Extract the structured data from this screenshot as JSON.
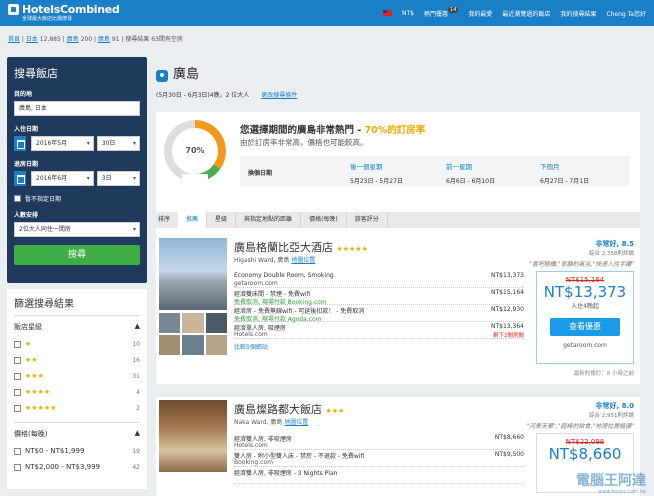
{
  "topbar": {
    "logo": "HotelsCombined",
    "tagline": "全球最大飯店比價搜尋",
    "currency": "NT$",
    "popular": "熱門優惠",
    "popular_badge": "14",
    "favorites": "我的最愛",
    "recent": "最近瀏覽過的飯店",
    "my_search": "我的搜尋結果",
    "user": "Cheng Ta您好"
  },
  "breadcrumb": {
    "home": "首頁",
    "japan": "日本",
    "japan_count": "12,885",
    "hiroshima_pref": "廣島",
    "pref_count": "200",
    "hiroshima_city": "廣島",
    "city_count": "91",
    "result": "搜尋結果 63間有空房"
  },
  "search": {
    "title": "搜尋飯店",
    "destination_label": "目的地",
    "destination_value": "廣島, 日本",
    "checkin_label": "入住日期",
    "checkin_month": "2016年5月",
    "checkin_day": "30日",
    "checkout_label": "退房日期",
    "checkout_month": "2016年6月",
    "checkout_day": "3日",
    "no_date": "暫不指定日期",
    "guests_label": "人數安排",
    "guests_value": "2位大人同住一間房",
    "button": "搜尋"
  },
  "filters": {
    "title": "篩選搜尋結果",
    "star_header": "飯店星級",
    "stars": [
      {
        "stars": "★",
        "count": "10"
      },
      {
        "stars": "★★",
        "count": "16"
      },
      {
        "stars": "★★★",
        "count": "31"
      },
      {
        "stars": "★★★★",
        "count": "4"
      },
      {
        "stars": "★★★★★",
        "count": "2"
      }
    ],
    "price_header": "價格(每晚)",
    "prices": [
      {
        "label": "NT$0 - NT$1,999",
        "count": "19"
      },
      {
        "label": "NT$2,000 - NT$3,999",
        "count": "42"
      }
    ]
  },
  "main": {
    "city": "廣島",
    "dates": "(5月30日 - 6月3日)4晚，2 位大人",
    "change": "更改搜尋條件",
    "gauge_value": "70%",
    "gauge_fill_fraction": 0.7,
    "popular_title": "您選擇期間的廣島非常熱門 - ",
    "popular_highlight": "70%的訂房率",
    "popular_sub": "由於訂房率非常高，價格也可能較高。",
    "change_dates_label": "換個日期",
    "alt_dates": [
      {
        "title": "後一個星期",
        "range": "5月23日 - 5月27日"
      },
      {
        "title": "前一星期",
        "range": "6月6日 - 6月10日"
      },
      {
        "title": "下個月",
        "range": "6月27日 - 7月1日"
      }
    ],
    "sort_label": "排序",
    "tabs": [
      "推薦",
      "星級",
      "與指定地點的距離",
      "價格(每晚)",
      "旅客評分"
    ]
  },
  "hotels": [
    {
      "name": "廣島格蘭比亞大酒店",
      "stars": "★★★★★",
      "address": "Higashi Ward, 廣島",
      "map": "地圖位置",
      "rating": "非常好, 8.5",
      "rating_count": "綜合 2,358則評論",
      "quote": "\"喜吧賠攤,\"寧靜的氣氛,\"快速入住手續\"",
      "offers": [
        {
          "name": "Economy Double Room, Smoking",
          "site": "getaroom.com",
          "price": "NT$13,373",
          "extra": ""
        },
        {
          "name": "經濟雙床間 - 禁煙 - 免費wifi",
          "site": "免費取消, 現場付款 Booking.com",
          "price": "NT$15,164",
          "extra": ""
        },
        {
          "name": "經濟房 - 免費無線wifi - 可延後扣款！ - 免費取消",
          "site": "免費取消, 現場付款 Agoda.com",
          "price": "NT$12,930",
          "extra": ""
        },
        {
          "name": "經濟單人房, 吸煙房",
          "site": "Hotels.com",
          "price": "NT$13,364",
          "extra": "剩下2間房間"
        }
      ],
      "compare": "比較5個網站",
      "old_price": "NT$15,164",
      "deal_price": "NT$13,373",
      "per_night": "入住4晚起",
      "deal_button": "查看優惠",
      "deal_site": "getaroom.com",
      "checked": "最新的搜訂：8 小時之前"
    },
    {
      "name": "廣島燦路都大飯店",
      "stars": "★★★",
      "address": "Naka Ward, 廣島",
      "map": "地圖位置",
      "rating": "非常好, 8.0",
      "rating_count": "綜合 2,951則評論",
      "quote": "\"河景天華\",\"超棒的飲食,\"地理位置極優\"",
      "offers": [
        {
          "name": "經濟雙人房, 非吸煙房",
          "site": "Hotels.com",
          "price": "NT$8,660",
          "extra": ""
        },
        {
          "name": "雙人房 - 附小型雙人床 - 禁菸 - 不退款 - 免費wifi",
          "site": "Booking.com",
          "price": "NT$9,500",
          "extra": ""
        },
        {
          "name": "經濟雙人房, 非吸煙房 - 3 Nights Plan",
          "site": "",
          "price": "NT$?",
          "extra": ""
        }
      ],
      "old_price": "NT$22,098",
      "deal_price": "NT$8,660"
    }
  ],
  "watermark": "電腦王阿達",
  "watermark_url": "www.kocpc.com.tw"
}
